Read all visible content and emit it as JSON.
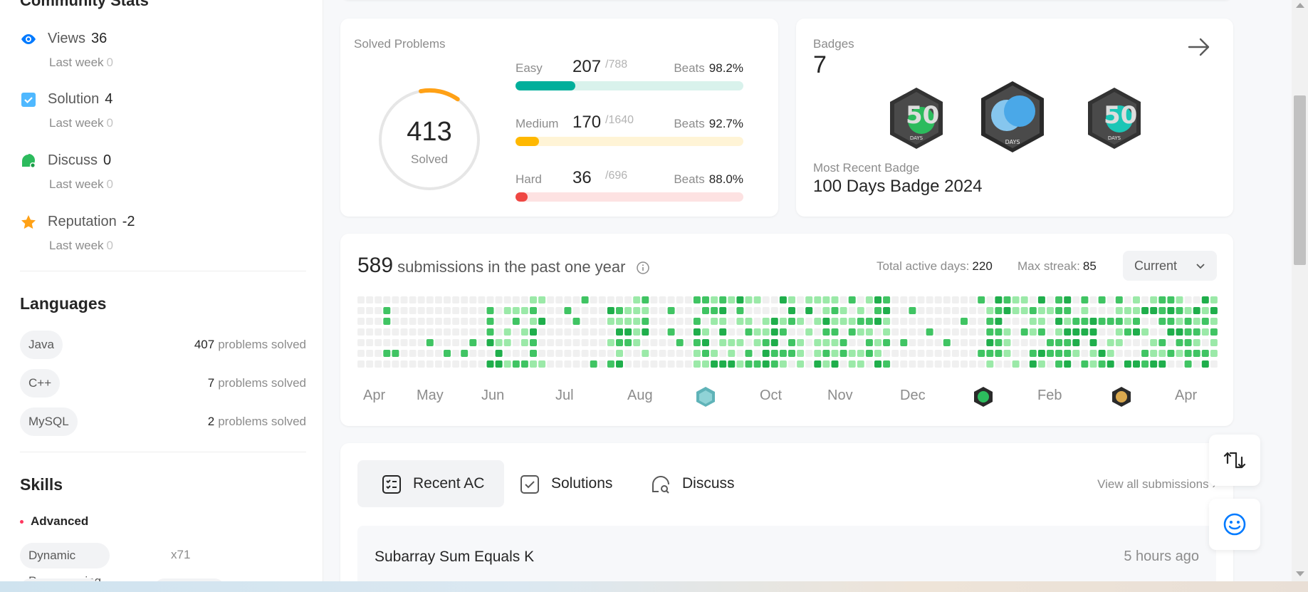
{
  "sidebar": {
    "title": "Community Stats",
    "stats": [
      {
        "label": "Views",
        "value": "36",
        "last_week_label": "Last week",
        "last_week_value": "0",
        "icon": "eye-icon",
        "color": "#007aff"
      },
      {
        "label": "Solution",
        "value": "4",
        "last_week_label": "Last week",
        "last_week_value": "0",
        "icon": "solution-check-icon",
        "color": "#4fb8ff"
      },
      {
        "label": "Discuss",
        "value": "0",
        "last_week_label": "Last week",
        "last_week_value": "0",
        "icon": "discuss-bubble-icon",
        "color": "#2cbb5d"
      },
      {
        "label": "Reputation",
        "value": "-2",
        "last_week_label": "Last week",
        "last_week_value": "0",
        "icon": "star-icon",
        "color": "#ffa116"
      }
    ],
    "languages_title": "Languages",
    "languages": [
      {
        "name": "Java",
        "count": "407",
        "suffix": "problems solved"
      },
      {
        "name": "C++",
        "count": "7",
        "suffix": "problems solved"
      },
      {
        "name": "MySQL",
        "count": "2",
        "suffix": "problems solved"
      }
    ],
    "skills_title": "Skills",
    "skill_level": "Advanced",
    "skills": [
      {
        "name": "Dynamic Programming",
        "count": "x71"
      }
    ]
  },
  "solved": {
    "title": "Solved Problems",
    "total": "413",
    "total_label": "Solved",
    "beats_label": "Beats",
    "difficulties": [
      {
        "name": "Easy",
        "solved": "207",
        "total": "/788",
        "beats": "98.2%",
        "color": "#00af9b",
        "track": "#d9f2ec",
        "fraction": 0.2627
      },
      {
        "name": "Medium",
        "solved": "170",
        "total": "/1640",
        "beats": "92.7%",
        "color": "#ffb800",
        "track": "#fff4d6",
        "fraction": 0.1037
      },
      {
        "name": "Hard",
        "solved": "36",
        "total": "/696",
        "beats": "88.0%",
        "color": "#ef4743",
        "track": "#fde2e2",
        "fraction": 0.0517
      }
    ]
  },
  "badges": {
    "title": "Badges",
    "count": "7",
    "recent_label": "Most Recent Badge",
    "recent_name": "100 Days Badge 2024",
    "items": [
      {
        "name": "50 Days Badge",
        "text": "50",
        "sub": "DAYS",
        "color": "#2cbb5d"
      },
      {
        "name": "100 Days Badge 2024",
        "text": "",
        "sub": "DAYS",
        "color": "#4aa8e8"
      },
      {
        "name": "50 Days Badge 2",
        "text": "50",
        "sub": "DAYS",
        "color": "#1bc6b6"
      }
    ]
  },
  "heatmap": {
    "count": "589",
    "title_suffix": "submissions in the past one year",
    "active_days_label": "Total active days:",
    "active_days": "220",
    "max_streak_label": "Max streak:",
    "max_streak": "85",
    "dropdown": "Current",
    "months": [
      "Apr",
      "May",
      "Jun",
      "Jul",
      "Aug",
      "Oct",
      "Nov",
      "Dec",
      "Feb",
      "Apr"
    ],
    "mini_badges": [
      "sep-badge-icon",
      "jan-badge-icon",
      "mar-badge-icon"
    ]
  },
  "recent": {
    "tabs": [
      {
        "label": "Recent AC",
        "icon": "list-check-icon"
      },
      {
        "label": "Solutions",
        "icon": "checkbox-icon"
      },
      {
        "label": "Discuss",
        "icon": "chat-search-icon"
      }
    ],
    "view_all": "View all submissions",
    "rows": [
      {
        "name": "Subarray Sum Equals K",
        "time": "5 hours ago"
      }
    ]
  }
}
